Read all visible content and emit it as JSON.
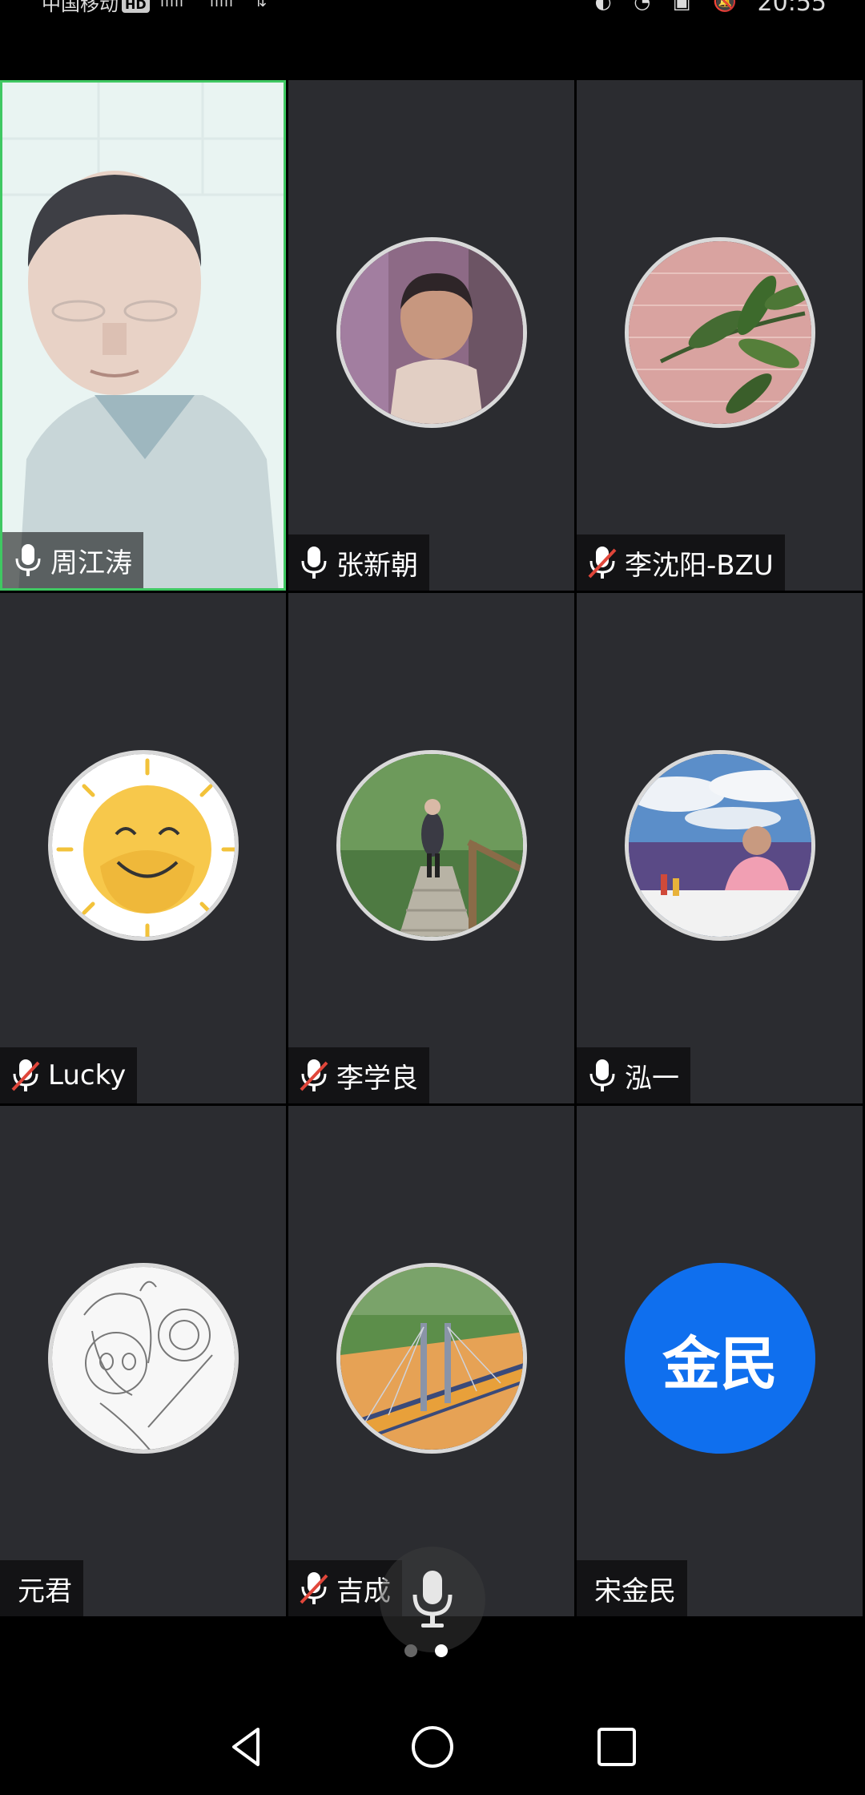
{
  "status_bar": {
    "carrier": "中国移动",
    "hd_badge": "HD",
    "signal1": "ıılll",
    "signal2": "ıılll",
    "wifi": "⇅",
    "icons": "◐ ◔ ▣ 🔕",
    "time": "20:55"
  },
  "participants": [
    {
      "name": "周江涛",
      "mic": "on",
      "avatar": "camera-feed",
      "active": true
    },
    {
      "name": "张新朝",
      "mic": "on",
      "avatar": "photo-child"
    },
    {
      "name": "李沈阳-BZU",
      "mic": "muted",
      "avatar": "photo-plant"
    },
    {
      "name": "Lucky",
      "mic": "muted",
      "avatar": "smiley-sun"
    },
    {
      "name": "李学良",
      "mic": "muted",
      "avatar": "photo-forest-hiker"
    },
    {
      "name": "泓一",
      "mic": "on",
      "avatar": "photo-man-lavender"
    },
    {
      "name": "元君",
      "mic": "none",
      "avatar": "sketch-anime"
    },
    {
      "name": "吉成",
      "mic": "muted",
      "avatar": "photo-bridge"
    },
    {
      "name": "宋金民",
      "mic": "none",
      "avatar": "text",
      "avatar_text": "金民"
    }
  ],
  "pager": {
    "count": 2,
    "current": 2
  },
  "colors": {
    "tile_bg": "#2b2c30",
    "active_border": "#3fc862",
    "text_avatar_bg": "#0f6fee",
    "muted_slash": "#e0463a"
  }
}
